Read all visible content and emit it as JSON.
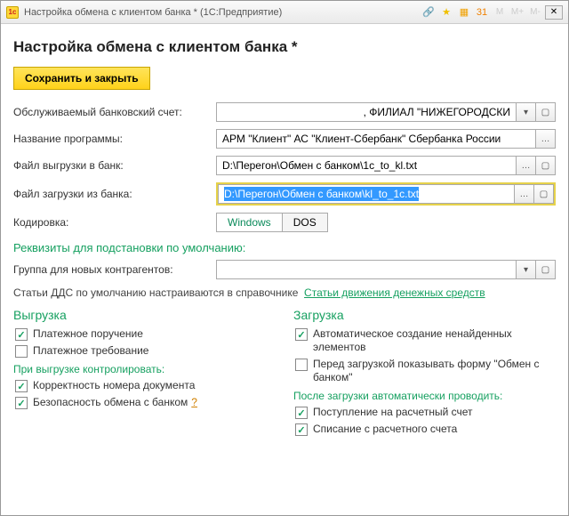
{
  "window": {
    "title": "Настройка обмена с клиентом банка * (1С:Предприятие)"
  },
  "page_title": "Настройка обмена с клиентом банка *",
  "save_button": "Сохранить и закрыть",
  "fields": {
    "account_label": "Обслуживаемый банковский счет:",
    "account_value": ", ФИЛИАЛ \"НИЖЕГОРОДСКИ",
    "program_label": "Название программы:",
    "program_value": "АРМ \"Клиент\" АС \"Клиент-Сбербанк\" Сбербанка России",
    "export_label": "Файл выгрузки в банк:",
    "export_value": "D:\\Перегон\\Обмен с банком\\1c_to_kl.txt",
    "import_label": "Файл загрузки из банка:",
    "import_value": "D:\\Перегон\\Обмен с банком\\kl_to_1c.txt",
    "encoding_label": "Кодировка:",
    "encoding_windows": "Windows",
    "encoding_dos": "DOS"
  },
  "defaults_section": "Реквизиты для подстановки по умолчанию:",
  "group_label": "Группа для новых контрагентов:",
  "group_value": "",
  "dds_hint_text": "Статьи ДДС по умолчанию настраиваются в справочнике",
  "dds_link": "Статьи движения денежных средств",
  "export": {
    "title": "Выгрузка",
    "pay_order": "Платежное поручение",
    "pay_req": "Платежное требование",
    "control_h": "При выгрузке контролировать:",
    "doc_num": "Корректность номера документа",
    "security": "Безопасность обмена с банком",
    "help": "?"
  },
  "import": {
    "title": "Загрузка",
    "auto_create": "Автоматическое создание ненайденных элементов",
    "show_form": "Перед загрузкой показывать форму \"Обмен с банком\"",
    "autopost_h": "После загрузки автоматически проводить:",
    "receipt": "Поступление на расчетный счет",
    "writeoff": "Списание с расчетного счета"
  },
  "titlebar_icons": {
    "m1": "M",
    "m_plus": "M+",
    "m_minus": "M-"
  }
}
